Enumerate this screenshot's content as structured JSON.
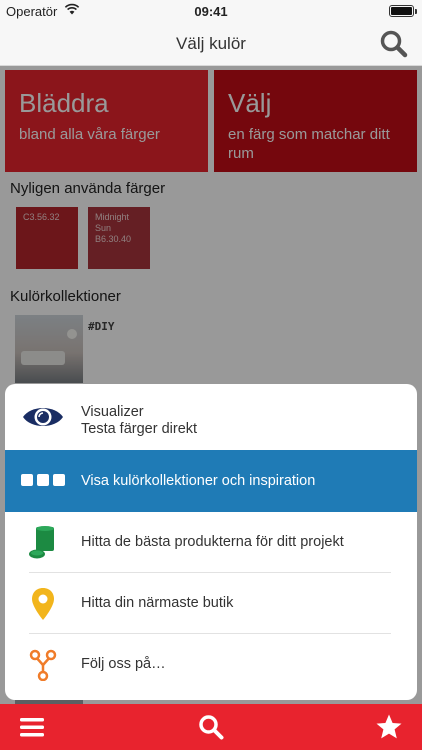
{
  "status_bar": {
    "carrier": "Operatör",
    "time": "09:41"
  },
  "nav": {
    "title": "Välj kulör",
    "search_icon": "search-icon"
  },
  "tiles": {
    "browse": {
      "title": "Bläddra",
      "subtitle": "bland alla våra färger",
      "color": "#e8232e"
    },
    "choose": {
      "title": "Välj",
      "subtitle": "en färg som matchar ditt rum",
      "color": "#c40d17"
    }
  },
  "recent": {
    "label": "Nyligen använda färger",
    "swatches": [
      {
        "name": "C3.56.32",
        "color": "#b5262c"
      },
      {
        "name": "Midnight Sun B6.30.40",
        "color": "#a8343d"
      }
    ]
  },
  "collections": {
    "label": "Kulörkollektioner",
    "items": [
      {
        "tag": "#DIY"
      }
    ]
  },
  "menu": {
    "items": [
      {
        "icon": "eye-icon",
        "line1": "Visualizer",
        "line2": "Testa färger direkt"
      },
      {
        "icon": "tiles-icon",
        "label": "Visa kulörkollektioner och inspiration",
        "highlight": "#1f7bb6"
      },
      {
        "icon": "paint-can-icon",
        "label": "Hitta de bästa produkterna för ditt projekt"
      },
      {
        "icon": "map-pin-icon",
        "label": "Hitta din närmaste butik"
      },
      {
        "icon": "share-icon",
        "label": "Följ oss på…"
      }
    ]
  },
  "tab_bar": {
    "color": "#e8232e",
    "items": [
      {
        "icon": "hamburger-menu-icon"
      },
      {
        "icon": "search-icon"
      },
      {
        "icon": "star-icon"
      }
    ]
  }
}
